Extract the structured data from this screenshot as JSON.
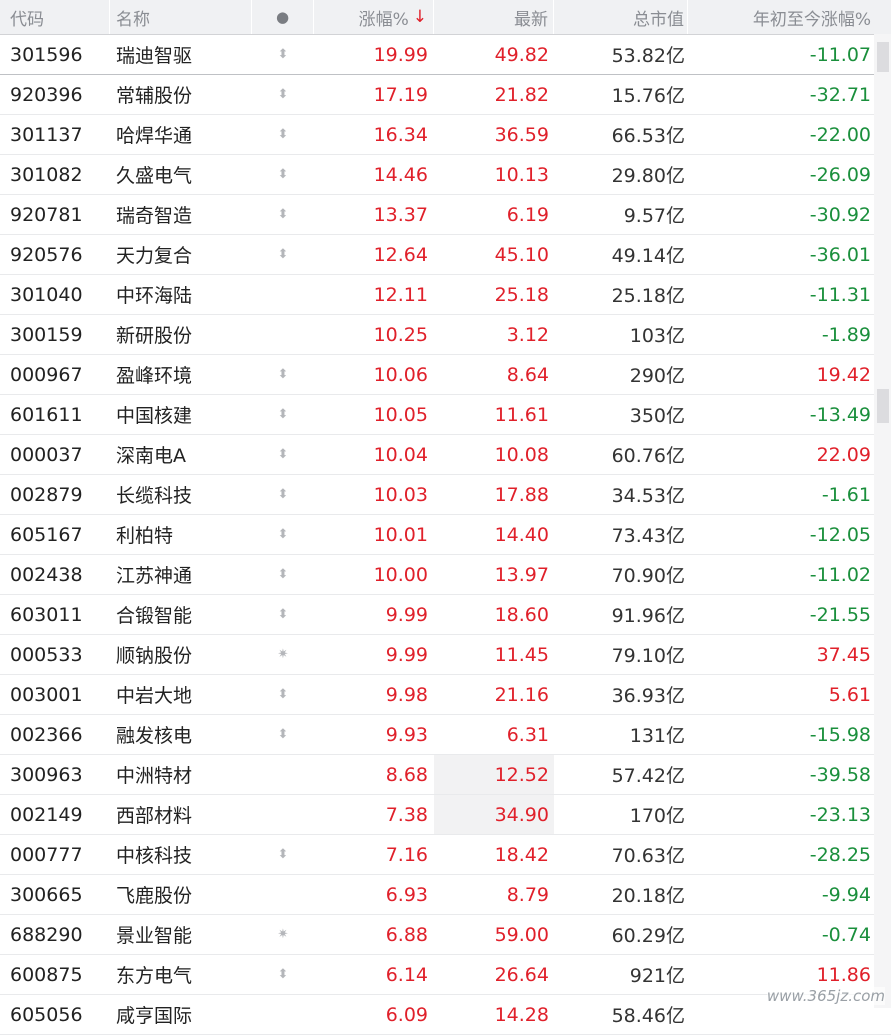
{
  "header": {
    "code": "代码",
    "name": "名称",
    "flag": "●",
    "change_pct": "涨幅%",
    "sort_arrow": "↓",
    "price": "最新",
    "market_cap": "总市值",
    "ytd": "年初至今涨幅%"
  },
  "colors": {
    "up": "#e0202a",
    "down": "#1a8f3c",
    "header_bg": "#f0f1f3"
  },
  "rows": [
    {
      "code": "301596",
      "name": "瑞迪智驱",
      "flag": "⬍",
      "chg": "19.99",
      "price": "49.82",
      "mcap": "53.82亿",
      "ytd": "-11.07",
      "ytd_dir": "down"
    },
    {
      "code": "920396",
      "name": "常辅股份",
      "flag": "⬍",
      "chg": "17.19",
      "price": "21.82",
      "mcap": "15.76亿",
      "ytd": "-32.71",
      "ytd_dir": "down"
    },
    {
      "code": "301137",
      "name": "哈焊华通",
      "flag": "⬍",
      "chg": "16.34",
      "price": "36.59",
      "mcap": "66.53亿",
      "ytd": "-22.00",
      "ytd_dir": "down"
    },
    {
      "code": "301082",
      "name": "久盛电气",
      "flag": "⬍",
      "chg": "14.46",
      "price": "10.13",
      "mcap": "29.80亿",
      "ytd": "-26.09",
      "ytd_dir": "down"
    },
    {
      "code": "920781",
      "name": "瑞奇智造",
      "flag": "⬍",
      "chg": "13.37",
      "price": "6.19",
      "mcap": "9.57亿",
      "ytd": "-30.92",
      "ytd_dir": "down"
    },
    {
      "code": "920576",
      "name": "天力复合",
      "flag": "⬍",
      "chg": "12.64",
      "price": "45.10",
      "mcap": "49.14亿",
      "ytd": "-36.01",
      "ytd_dir": "down"
    },
    {
      "code": "301040",
      "name": "中环海陆",
      "flag": "",
      "chg": "12.11",
      "price": "25.18",
      "mcap": "25.18亿",
      "ytd": "-11.31",
      "ytd_dir": "down"
    },
    {
      "code": "300159",
      "name": "新研股份",
      "flag": "",
      "chg": "10.25",
      "price": "3.12",
      "mcap": "103亿",
      "ytd": "-1.89",
      "ytd_dir": "down"
    },
    {
      "code": "000967",
      "name": "盈峰环境",
      "flag": "⬍",
      "chg": "10.06",
      "price": "8.64",
      "mcap": "290亿",
      "ytd": "19.42",
      "ytd_dir": "up"
    },
    {
      "code": "601611",
      "name": "中国核建",
      "flag": "⬍",
      "chg": "10.05",
      "price": "11.61",
      "mcap": "350亿",
      "ytd": "-13.49",
      "ytd_dir": "down"
    },
    {
      "code": "000037",
      "name": "深南电A",
      "flag": "⬍",
      "chg": "10.04",
      "price": "10.08",
      "mcap": "60.76亿",
      "ytd": "22.09",
      "ytd_dir": "up"
    },
    {
      "code": "002879",
      "name": "长缆科技",
      "flag": "⬍",
      "chg": "10.03",
      "price": "17.88",
      "mcap": "34.53亿",
      "ytd": "-1.61",
      "ytd_dir": "down"
    },
    {
      "code": "605167",
      "name": "利柏特",
      "flag": "⬍",
      "chg": "10.01",
      "price": "14.40",
      "mcap": "73.43亿",
      "ytd": "-12.05",
      "ytd_dir": "down"
    },
    {
      "code": "002438",
      "name": "江苏神通",
      "flag": "⬍",
      "chg": "10.00",
      "price": "13.97",
      "mcap": "70.90亿",
      "ytd": "-11.02",
      "ytd_dir": "down"
    },
    {
      "code": "603011",
      "name": "合锻智能",
      "flag": "⬍",
      "chg": "9.99",
      "price": "18.60",
      "mcap": "91.96亿",
      "ytd": "-21.55",
      "ytd_dir": "down"
    },
    {
      "code": "000533",
      "name": "顺钠股份",
      "flag": "✷",
      "chg": "9.99",
      "price": "11.45",
      "mcap": "79.10亿",
      "ytd": "37.45",
      "ytd_dir": "up"
    },
    {
      "code": "003001",
      "name": "中岩大地",
      "flag": "⬍",
      "chg": "9.98",
      "price": "21.16",
      "mcap": "36.93亿",
      "ytd": "5.61",
      "ytd_dir": "up"
    },
    {
      "code": "002366",
      "name": "融发核电",
      "flag": "⬍",
      "chg": "9.93",
      "price": "6.31",
      "mcap": "131亿",
      "ytd": "-15.98",
      "ytd_dir": "down"
    },
    {
      "code": "300963",
      "name": "中洲特材",
      "flag": "",
      "chg": "8.68",
      "price": "12.52",
      "mcap": "57.42亿",
      "ytd": "-39.58",
      "ytd_dir": "down"
    },
    {
      "code": "002149",
      "name": "西部材料",
      "flag": "",
      "chg": "7.38",
      "price": "34.90",
      "mcap": "170亿",
      "ytd": "-23.13",
      "ytd_dir": "down"
    },
    {
      "code": "000777",
      "name": "中核科技",
      "flag": "⬍",
      "chg": "7.16",
      "price": "18.42",
      "mcap": "70.63亿",
      "ytd": "-28.25",
      "ytd_dir": "down"
    },
    {
      "code": "300665",
      "name": "飞鹿股份",
      "flag": "",
      "chg": "6.93",
      "price": "8.79",
      "mcap": "20.18亿",
      "ytd": "-9.94",
      "ytd_dir": "down"
    },
    {
      "code": "688290",
      "name": "景业智能",
      "flag": "✷",
      "chg": "6.88",
      "price": "59.00",
      "mcap": "60.29亿",
      "ytd": "-0.74",
      "ytd_dir": "down"
    },
    {
      "code": "600875",
      "name": "东方电气",
      "flag": "⬍",
      "chg": "6.14",
      "price": "26.64",
      "mcap": "921亿",
      "ytd": "11.86",
      "ytd_dir": "up"
    },
    {
      "code": "605056",
      "name": "咸亨国际",
      "flag": "",
      "chg": "6.09",
      "price": "14.28",
      "mcap": "58.46亿",
      "ytd": "",
      "ytd_dir": "down"
    }
  ],
  "watermark": "www.365jz.com"
}
